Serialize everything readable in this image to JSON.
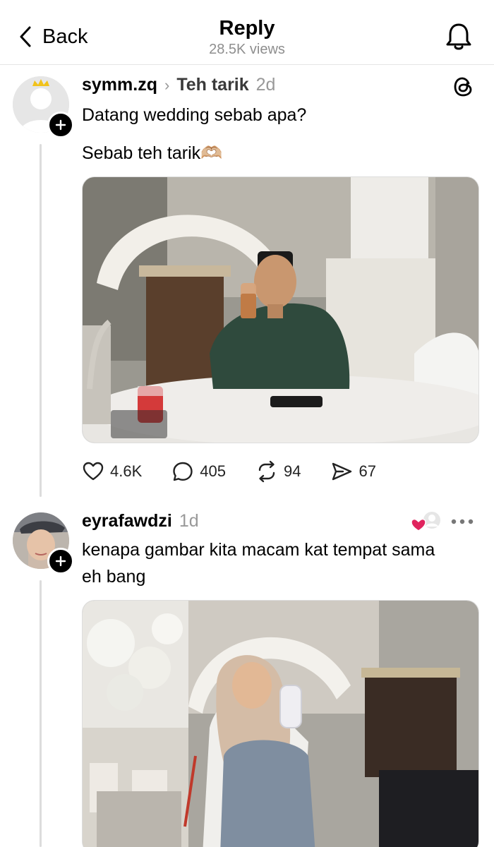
{
  "header": {
    "back_label": "Back",
    "title": "Reply",
    "views": "28.5K views"
  },
  "posts": [
    {
      "username": "symm.zq",
      "topic": "Teh tarik",
      "time": "2d",
      "text_lines": [
        "Datang wedding sebab apa?",
        "Sebab teh tarik🫶🏼"
      ],
      "stats": {
        "likes": "4.6K",
        "replies": "405",
        "reposts": "94",
        "shares": "67"
      }
    },
    {
      "username": "eyrafawdzi",
      "time": "1d",
      "text_lines": [
        "kenapa gambar kita macam kat tempat sama",
        "eh bang"
      ]
    }
  ],
  "colors": {
    "accent_heart": "#e0245e",
    "muted_text": "#8e8e8e",
    "thread_line": "#dcdcdc"
  },
  "icons": {
    "back": "chevron-left-icon",
    "bell": "bell-icon",
    "threads": "threads-logo-icon",
    "like": "heart-icon",
    "reply": "comment-icon",
    "repost": "repost-icon",
    "share": "send-icon",
    "more": "more-horizontal-icon",
    "follow": "plus-icon"
  }
}
